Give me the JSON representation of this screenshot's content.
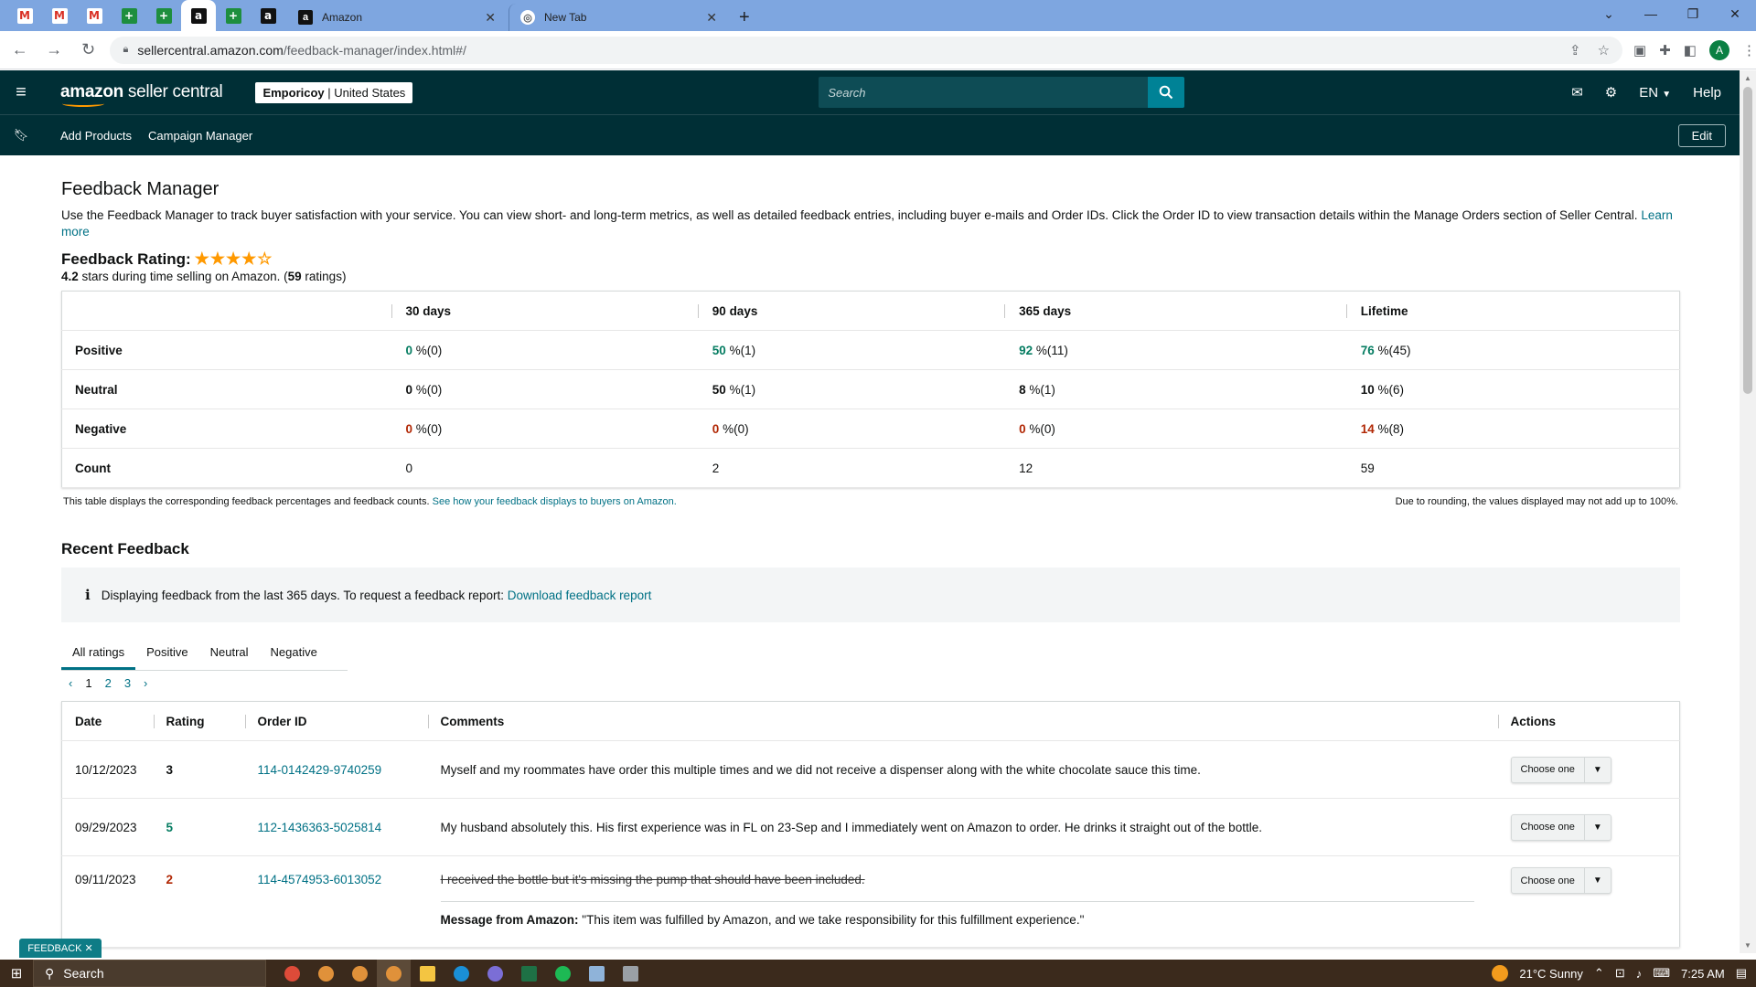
{
  "browser": {
    "tabs": [
      {
        "title": "Amazon",
        "close": "✕"
      },
      {
        "title": "New Tab",
        "close": "✕"
      }
    ],
    "new_tab": "+",
    "url_host": "sellercentral.amazon.com",
    "url_path": "/feedback-manager/index.html#/",
    "profile_initial": "A"
  },
  "header": {
    "logo_main": "amazon",
    "logo_sub": " seller central",
    "store_name": "Emporicoy",
    "store_region": "| United States",
    "search_placeholder": "Search",
    "language": "EN",
    "help": "Help"
  },
  "nav": {
    "links": [
      "Add Products",
      "Campaign Manager"
    ],
    "edit": "Edit"
  },
  "page": {
    "title": "Feedback Manager",
    "intro": "Use the Feedback Manager to track buyer satisfaction with your service. You can view short- and long-term metrics, as well as detailed feedback entries, including buyer e-mails and Order IDs. Click the Order ID to view transaction details within the Manage Orders section of Seller Central.",
    "learn_more": "Learn more",
    "rating_label": "Feedback Rating:",
    "stars": "★★★★☆",
    "rating_value": "4.2",
    "rating_text": " stars during time selling on Amazon. (",
    "rating_count": "59",
    "rating_suffix": " ratings)"
  },
  "metrics": {
    "columns": [
      "30 days",
      "90 days",
      "365 days",
      "Lifetime"
    ],
    "rows": [
      {
        "label": "Positive",
        "cells": [
          {
            "n": "0",
            "s": " %(0)"
          },
          {
            "n": "50",
            "s": " %(1)"
          },
          {
            "n": "92",
            "s": " %(11)"
          },
          {
            "n": "76",
            "s": " %(45)"
          }
        ]
      },
      {
        "label": "Neutral",
        "cells": [
          {
            "n": "0",
            "s": " %(0)"
          },
          {
            "n": "50",
            "s": " %(1)"
          },
          {
            "n": "8",
            "s": " %(1)"
          },
          {
            "n": "10",
            "s": " %(6)"
          }
        ]
      },
      {
        "label": "Negative",
        "cells": [
          {
            "n": "0",
            "s": " %(0)"
          },
          {
            "n": "0",
            "s": " %(0)"
          },
          {
            "n": "0",
            "s": " %(0)"
          },
          {
            "n": "14",
            "s": " %(8)"
          }
        ]
      },
      {
        "label": "Count",
        "cells": [
          {
            "n": "0",
            "s": ""
          },
          {
            "n": "2",
            "s": ""
          },
          {
            "n": "12",
            "s": ""
          },
          {
            "n": "59",
            "s": ""
          }
        ]
      }
    ],
    "note_left": "This table displays the corresponding feedback percentages and feedback counts.",
    "note_link": "See how your feedback displays to buyers on Amazon.",
    "note_right": "Due to rounding, the values displayed may not add up to 100%."
  },
  "recent": {
    "title": "Recent Feedback",
    "alert_text": "Displaying feedback from the last 365 days. To request a feedback report:",
    "alert_link": "Download feedback report",
    "tabs": [
      "All ratings",
      "Positive",
      "Neutral",
      "Negative"
    ],
    "pages": [
      "1",
      "2",
      "3"
    ],
    "columns": [
      "Date",
      "Rating",
      "Order ID",
      "Comments",
      "Actions"
    ],
    "action_label": "Choose one",
    "rows": [
      {
        "date": "10/12/2023",
        "rating": "3",
        "order": "114-0142429-9740259",
        "comment": "Myself and my roommates have order this multiple times and we did not receive a dispenser along with the white chocolate sauce this time."
      },
      {
        "date": "09/29/2023",
        "rating": "5",
        "order": "112-1436363-5025814",
        "comment": "My husband absolutely this. His first experience was in FL on 23-Sep and I immediately went on Amazon to order. He drinks it straight out of the bottle."
      },
      {
        "date": "09/11/2023",
        "rating": "2",
        "order": "114-4574953-6013052",
        "comment": "I received the bottle but it's missing the pump that should have been included.",
        "msg_label": "Message from Amazon:",
        "msg_text": " \"This item was fulfilled by Amazon, and we take responsibility for this fulfillment experience.\""
      }
    ]
  },
  "feedback_badge": "FEEDBACK ✕",
  "taskbar": {
    "search": "Search",
    "weather": "21°C  Sunny",
    "time": "7:25 AM"
  },
  "colors": {
    "header_bg": "#002f36",
    "positive": "#067d62",
    "negative": "#b12704",
    "link": "#007185"
  }
}
